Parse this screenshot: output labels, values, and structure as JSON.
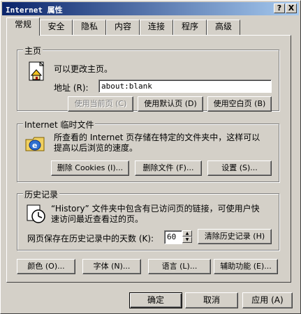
{
  "window": {
    "title": "Internet 属性",
    "help_label": "?",
    "close_label": "X"
  },
  "tabs": [
    {
      "label": "常规",
      "active": true
    },
    {
      "label": "安全"
    },
    {
      "label": "隐私"
    },
    {
      "label": "内容"
    },
    {
      "label": "连接"
    },
    {
      "label": "程序"
    },
    {
      "label": "高级"
    }
  ],
  "homepage": {
    "group_title": "主页",
    "description": "可以更改主页。",
    "address_label": "地址 (R):",
    "address_value": "about:blank",
    "use_current_label": "使用当前页 (C)",
    "use_default_label": "使用默认页 (D)",
    "use_blank_label": "使用空白页 (B)"
  },
  "temp_files": {
    "group_title": "Internet 临时文件",
    "description_line1": "所查看的 Internet 页存储在特定的文件夹中，这样可以",
    "description_line2": "提高以后浏览的速度。",
    "delete_cookies_label": "删除 Cookies (I)...",
    "delete_files_label": "删除文件 (F)...",
    "settings_label": "设置 (S)..."
  },
  "history": {
    "group_title": "历史记录",
    "description_line1": "“History” 文件夹中包含有已访问页的链接，可使用户快",
    "description_line2": "速访问最近查看过的页。",
    "days_label": "网页保存在历史记录中的天数 (K):",
    "days_value": "60",
    "clear_history_label": "清除历史记录 (H)"
  },
  "bottom_buttons": {
    "colors_label": "颜色 (O)...",
    "fonts_label": "字体 (N)...",
    "languages_label": "语言 (L)...",
    "accessibility_label": "辅助功能 (E)..."
  },
  "dialog_buttons": {
    "ok_label": "确定",
    "cancel_label": "取消",
    "apply_label": "应用 (A)"
  }
}
